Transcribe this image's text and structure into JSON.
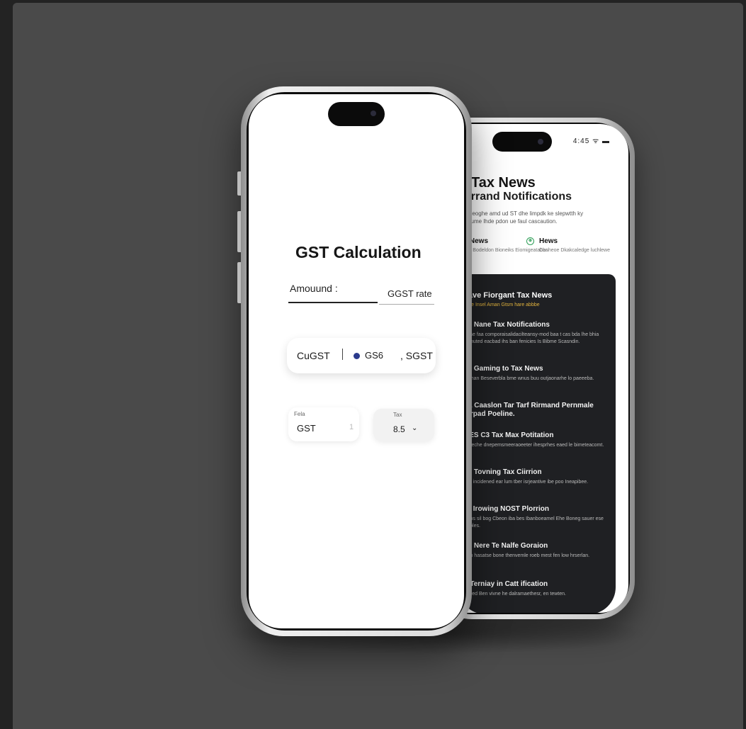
{
  "front": {
    "title": "GST Calculation",
    "amount_label": "Amouund :",
    "rate_label": "GGST rate",
    "tax_types": [
      "CuGST",
      "GS6",
      ", SGST"
    ],
    "gst_field": {
      "label": "Fela",
      "value": "GST",
      "cursor": "1"
    },
    "tax_field": {
      "label": "Tax",
      "value": "8.5",
      "chevron": "⌄"
    }
  },
  "back": {
    "status_left": "↗",
    "status_right": "4:45 ᯤ ▬",
    "title": "Tax News",
    "subtitle": "cerrand Notifications",
    "description": "kaddeoghe amd ud ST dhe limpdk ke slepwtth ky ptryfume lhde pdon ue faul cascaution.",
    "tabs": [
      {
        "label": "ax News",
        "sub": "lidion Bodeldon Bioneiks Eiomigeatabbs"
      },
      {
        "label": "Hews",
        "sub": "Canheoe Dkakcaledge luchlewe"
      }
    ],
    "tab_icon": "⊕",
    "panel_heading": "Tave Fiorgant Tax News",
    "panel_heading_sub": "Alue Insel Aman Gtsm hare abbbe",
    "news": [
      {
        "title": "24 Nane Tax Notifications",
        "desc": "Ease faa comporaisalidacilteansy-mod baa t cas bda lhe bhia ssmuted eacbad ihs ban fenicies Is Bibme Scasndin."
      },
      {
        "title": "83 Gaming to Tax News",
        "desc": "Bishan Beseverbla bme wnus buu outjaonarhe lo paeeeba."
      },
      {
        "title": "1L Caaslon Tar Tarf Rirmand Pernmale ferpad Poeline.",
        "desc": ""
      },
      {
        "title": "CES C3 Tax Max Potitation",
        "desc": "Erseche dnepemsmeeraoeeter ihesprhes eaed le bimeteacomt."
      },
      {
        "title": "81 Tovning Tax Ciirrion",
        "desc": "Tok incidened ear lum tber isrjeantive ibe poo Ineapibee."
      },
      {
        "title": "IN Irowing NOST Plorrion",
        "desc": "Bons sil bog Cbeon iba bes Ibanboeamel Ehe Boneg sauer ese ferbles."
      },
      {
        "title": "16 Nere Te Nalfe Goraion",
        "desc": "Ban hasatse bone thenvemle roeb mest fen low hrserlan."
      },
      {
        "title": "I/ Terniay in Catt ification",
        "desc": "Silved Ben vivne he dalramaethesr, en tewten."
      }
    ]
  }
}
